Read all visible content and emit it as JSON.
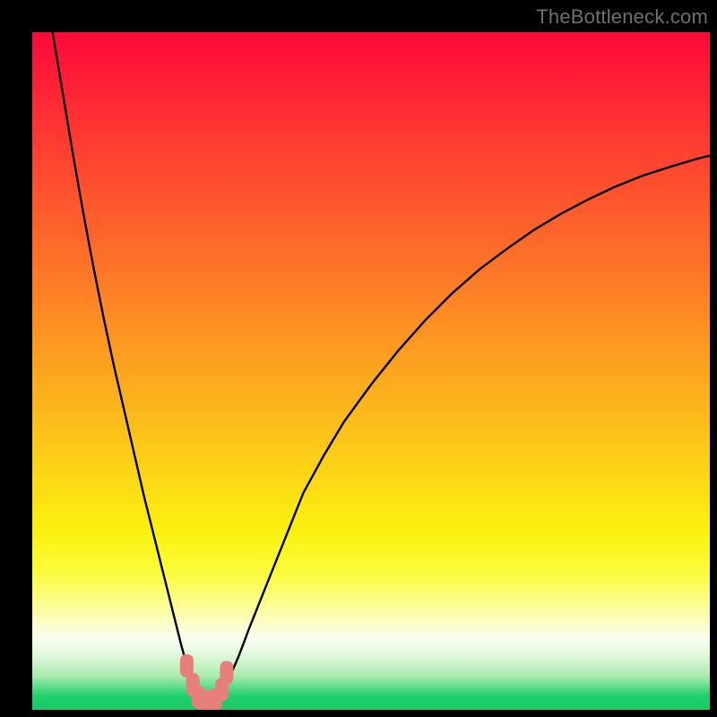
{
  "watermark": {
    "text": "TheBottleneck.com"
  },
  "colors": {
    "border": "#000000",
    "curve": "#000000",
    "marker_fill": "#e77f7d",
    "grad_top": "#fe093a",
    "grad_orange": "#fd7f26",
    "grad_yellow": "#fcf210",
    "grad_ltyellow": "#fbfd40",
    "grad_paleyellow": "#fcfeb0",
    "grad_white": "#f9fef1",
    "grad_mint": "#def8da",
    "grad_lightg": "#aaecaf",
    "grad_green": "#1ecf6a",
    "grad_darkg": "#1bcb67"
  },
  "chart_data": {
    "type": "line",
    "title": "",
    "xlabel": "",
    "ylabel": "",
    "xlim": [
      0,
      100
    ],
    "ylim": [
      0,
      100
    ],
    "series": [
      {
        "name": "curve",
        "x": [
          3.0,
          4.5,
          6.0,
          7.5,
          9.0,
          10.5,
          12.0,
          13.5,
          15.0,
          16.5,
          18.0,
          19.5,
          21.0,
          22.0,
          22.7,
          23.0,
          23.5,
          24.0,
          24.5,
          25.3,
          25.8,
          26.5,
          27.0,
          27.5,
          28.0,
          29.0,
          30.5,
          32.0,
          34.0,
          36.0,
          38.0,
          40.0,
          43.0,
          46.0,
          50.0,
          54.0,
          58.0,
          62.0,
          66.0,
          70.0,
          74.0,
          78.0,
          82.0,
          86.0,
          90.0,
          94.0,
          98.0,
          100.0
        ],
        "values": [
          100.0,
          91.0,
          82.0,
          73.5,
          65.5,
          58.0,
          51.0,
          44.5,
          38.0,
          31.5,
          25.5,
          19.5,
          13.5,
          9.5,
          7.0,
          5.5,
          3.7,
          2.4,
          1.6,
          1.2,
          1.1,
          1.1,
          1.3,
          1.7,
          2.4,
          4.5,
          8.0,
          12.0,
          17.0,
          22.0,
          27.0,
          32.0,
          37.5,
          42.5,
          48.0,
          53.0,
          57.5,
          61.5,
          65.0,
          68.0,
          70.8,
          73.2,
          75.3,
          77.2,
          78.8,
          80.1,
          81.3,
          81.8
        ]
      }
    ],
    "markers": {
      "name": "highlight",
      "style": "rounded",
      "x": [
        22.8,
        23.7,
        24.5,
        25.3,
        26.2,
        27.0,
        28.0,
        28.7
      ],
      "values": [
        6.5,
        3.7,
        1.9,
        1.2,
        1.2,
        1.5,
        3.0,
        5.5
      ]
    }
  }
}
